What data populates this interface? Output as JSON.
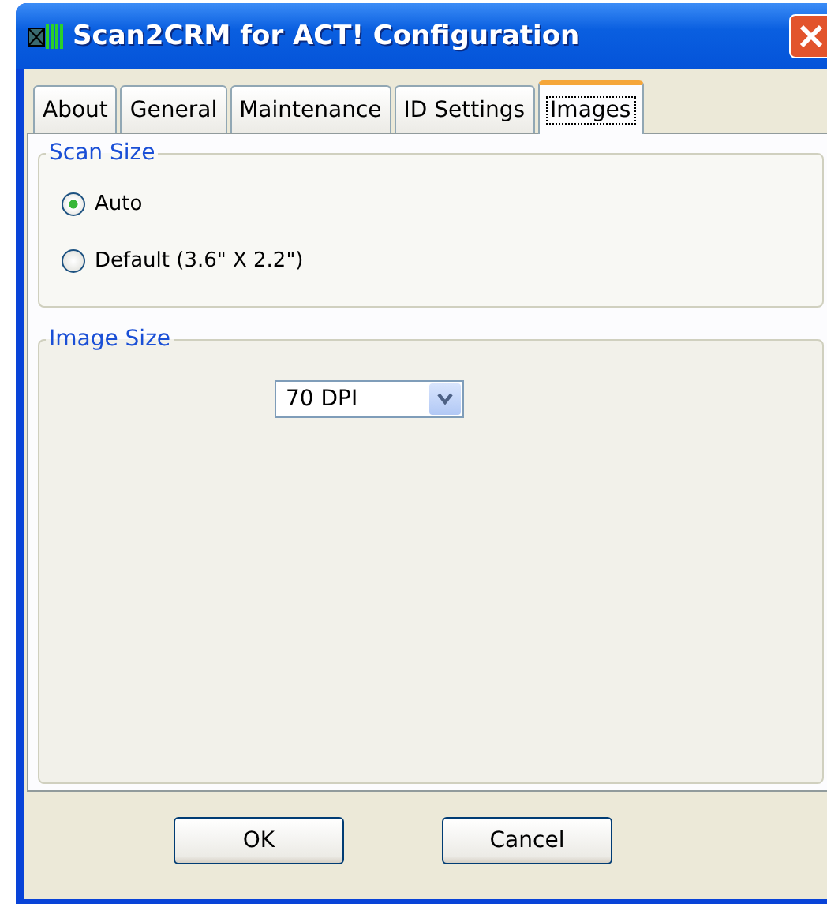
{
  "window": {
    "title": "Scan2CRM for ACT! Configuration"
  },
  "tabs": [
    {
      "label": "About",
      "selected": false
    },
    {
      "label": "General",
      "selected": false
    },
    {
      "label": "Maintenance",
      "selected": false
    },
    {
      "label": "ID Settings",
      "selected": false
    },
    {
      "label": "Images",
      "selected": true
    }
  ],
  "scan_size": {
    "title": "Scan Size",
    "options": [
      {
        "label": "Auto",
        "selected": true
      },
      {
        "label": "Default (3.6\" X 2.2\")",
        "selected": false
      }
    ]
  },
  "image_size": {
    "title": "Image Size",
    "dropdown": {
      "value": "70 DPI"
    }
  },
  "buttons": [
    "OK",
    "Cancel"
  ]
}
